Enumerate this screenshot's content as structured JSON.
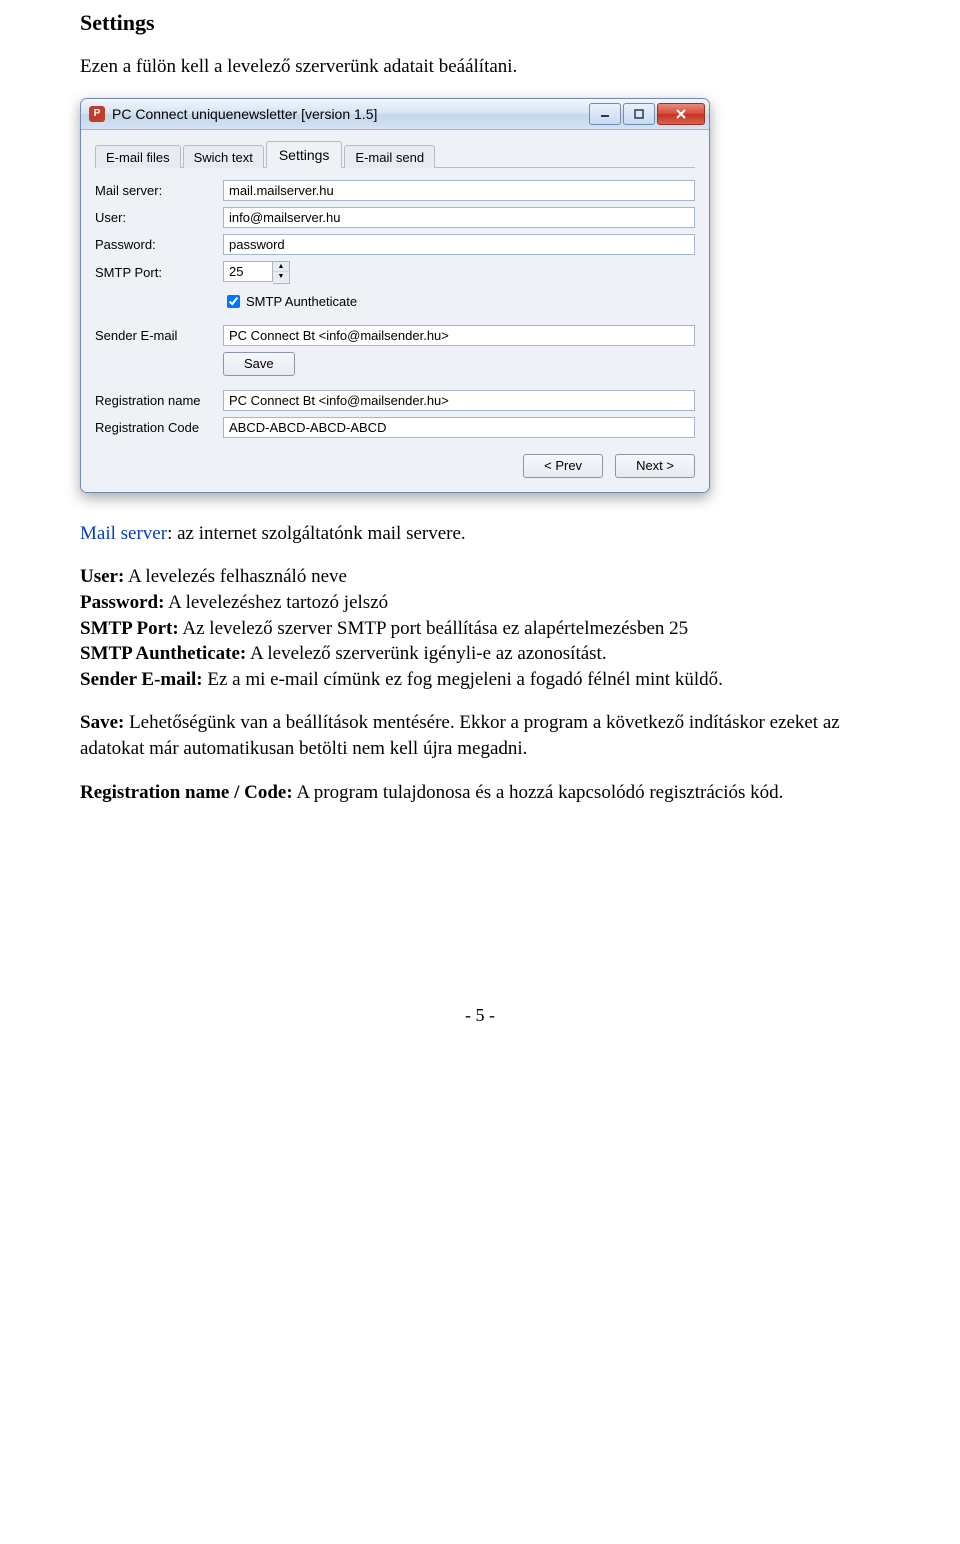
{
  "doc": {
    "heading": "Settings",
    "intro": "Ezen a fülön kell a levelező szerverünk adatait beáálítani.",
    "p_mailserver_lbl": "Mail server",
    "p_mailserver_txt": ": az internet szolgáltatónk mail servere.",
    "p1": [
      {
        "b": true,
        "t": "User:"
      },
      {
        "t": " A levelezés felhasználó neve"
      }
    ],
    "p2": [
      {
        "b": true,
        "t": "Password:"
      },
      {
        "t": " A levelezéshez tartozó jelszó"
      }
    ],
    "p3": [
      {
        "b": true,
        "t": "SMTP Port:"
      },
      {
        "t": " Az levelező szerver SMTP port beállítása ez alapértelmezésben 25"
      }
    ],
    "p4": [
      {
        "b": true,
        "t": "SMTP Auntheticate:"
      },
      {
        "t": " A levelező szerverünk igényli-e az azonosítást."
      }
    ],
    "p5": [
      {
        "b": true,
        "t": "Sender E-mail:"
      },
      {
        "t": " Ez a mi e-mail címünk ez fog megjeleni a fogadó félnél mint küldő."
      }
    ],
    "p6": [
      {
        "b": true,
        "t": "Save:"
      },
      {
        "t": " Lehetőségünk van a beállítások mentésére. Ekkor a program a következő indításkor ezeket az adatokat már automatikusan betölti nem kell újra megadni."
      }
    ],
    "p7": [
      {
        "b": true,
        "t": "Registration name / Code:"
      },
      {
        "t": " A program tulajdonosa és a hozzá kapcsolódó regisztrációs kód."
      }
    ],
    "page_num": "- 5 -"
  },
  "win": {
    "title": "PC Connect uniquenewsletter [version 1.5]",
    "tabs": [
      "E-mail files",
      "Swich text",
      "Settings",
      "E-mail send"
    ],
    "active_tab_index": 2,
    "labels": {
      "mail_server": "Mail server:",
      "user": "User:",
      "password": "Password:",
      "smtp_port": "SMTP Port:",
      "smtp_auth": "SMTP Auntheticate",
      "sender": "Sender E-mail",
      "save": "Save",
      "reg_name": "Registration name",
      "reg_code": "Registration Code",
      "prev": "< Prev",
      "next": "Next >"
    },
    "values": {
      "mail_server": "mail.mailserver.hu",
      "user": "info@mailserver.hu",
      "password": "password",
      "smtp_port": "25",
      "smtp_auth_checked": true,
      "sender": "PC Connect Bt <info@mailsender.hu>",
      "reg_name": "PC Connect Bt <info@mailsender.hu>",
      "reg_code": "ABCD-ABCD-ABCD-ABCD"
    }
  }
}
